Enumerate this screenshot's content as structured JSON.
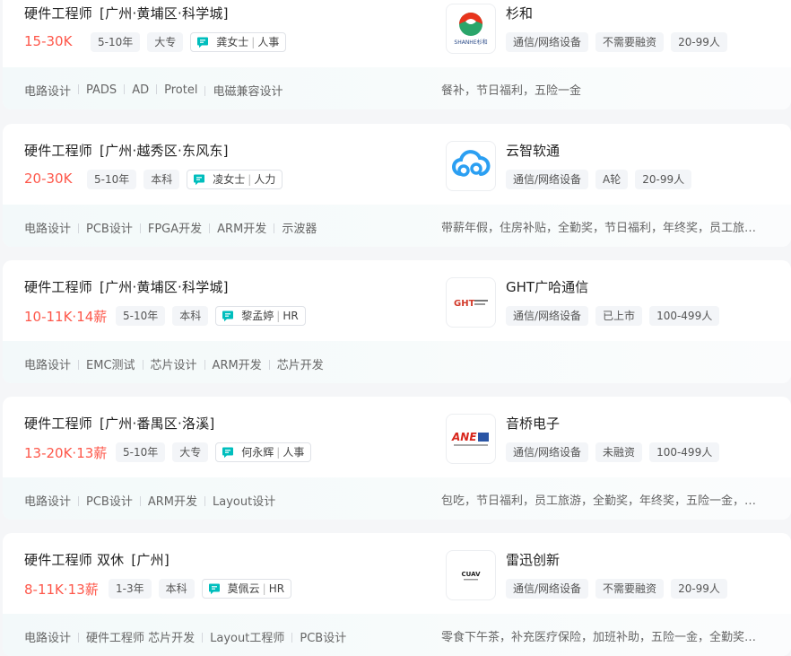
{
  "jobs": [
    {
      "title": "硬件工程师",
      "area": "[广州·黄埔区·科学城]",
      "salary": "15-30K",
      "experience": "5-10年",
      "degree": "大专",
      "recruiter": {
        "name": "龚女士",
        "role": "人事"
      },
      "skills": [
        "电路设计",
        "PADS",
        "AD",
        "Protel",
        "电磁兼容设计"
      ],
      "company": {
        "name": "杉和",
        "logo_text": "SHANHE杉和",
        "logo_icon": "shanhe-logo",
        "tags": [
          "通信/网络设备",
          "不需要融资",
          "20-99人"
        ]
      },
      "benefits": "餐补，节日福利，五险一金"
    },
    {
      "title": "硬件工程师",
      "area": "[广州·越秀区·东风东]",
      "salary": "20-30K",
      "experience": "5-10年",
      "degree": "本科",
      "recruiter": {
        "name": "凌女士",
        "role": "人力"
      },
      "skills": [
        "电路设计",
        "PCB设计",
        "FPGA开发",
        "ARM开发",
        "示波器"
      ],
      "company": {
        "name": "云智软通",
        "logo_icon": "cloud-logo",
        "tags": [
          "通信/网络设备",
          "A轮",
          "20-99人"
        ]
      },
      "benefits": "带薪年假，住房补贴，全勤奖，节日福利，年终奖，员工旅游，定期体检"
    },
    {
      "title": "硬件工程师",
      "area": "[广州·黄埔区·科学城]",
      "salary": "10-11K·14薪",
      "experience": "5-10年",
      "degree": "本科",
      "recruiter": {
        "name": "黎孟婷",
        "role": "HR"
      },
      "skills": [
        "电路设计",
        "EMC测试",
        "芯片设计",
        "ARM开发",
        "芯片开发"
      ],
      "company": {
        "name": "GHT广哈通信",
        "logo_text": "GHT",
        "logo_icon": "ght-logo",
        "tags": [
          "通信/网络设备",
          "已上市",
          "100-499人"
        ]
      },
      "benefits": ""
    },
    {
      "title": "硬件工程师",
      "area": "[广州·番禺区·洛溪]",
      "salary": "13-20K·13薪",
      "experience": "5-10年",
      "degree": "大专",
      "recruiter": {
        "name": "何永辉",
        "role": "人事"
      },
      "skills": [
        "电路设计",
        "PCB设计",
        "ARM开发",
        "Layout设计"
      ],
      "company": {
        "name": "音桥电子",
        "logo_text": "ANE",
        "logo_icon": "ane-logo",
        "tags": [
          "通信/网络设备",
          "未融资",
          "100-499人"
        ]
      },
      "benefits": "包吃，节日福利，员工旅游，全勤奖，年终奖，五险一金，定期体检"
    },
    {
      "title": "硬件工程师 双休",
      "area": "[广州]",
      "salary": "8-11K·13薪",
      "experience": "1-3年",
      "degree": "本科",
      "recruiter": {
        "name": "莫佩云",
        "role": "HR"
      },
      "skills": [
        "电路设计",
        "硬件工程师 芯片开发",
        "Layout工程师",
        "PCB设计"
      ],
      "company": {
        "name": "雷迅创新",
        "logo_text": "CUAV",
        "logo_icon": "cuav-logo",
        "tags": [
          "通信/网络设备",
          "不需要融资",
          "20-99人"
        ]
      },
      "benefits": "零食下午茶，补充医疗保险，加班补助，五险一金，全勤奖，节日福利"
    }
  ],
  "colors": {
    "salary": "#fe574a",
    "chat_icon": "#00bebd",
    "accent_red": "#e8341c"
  }
}
